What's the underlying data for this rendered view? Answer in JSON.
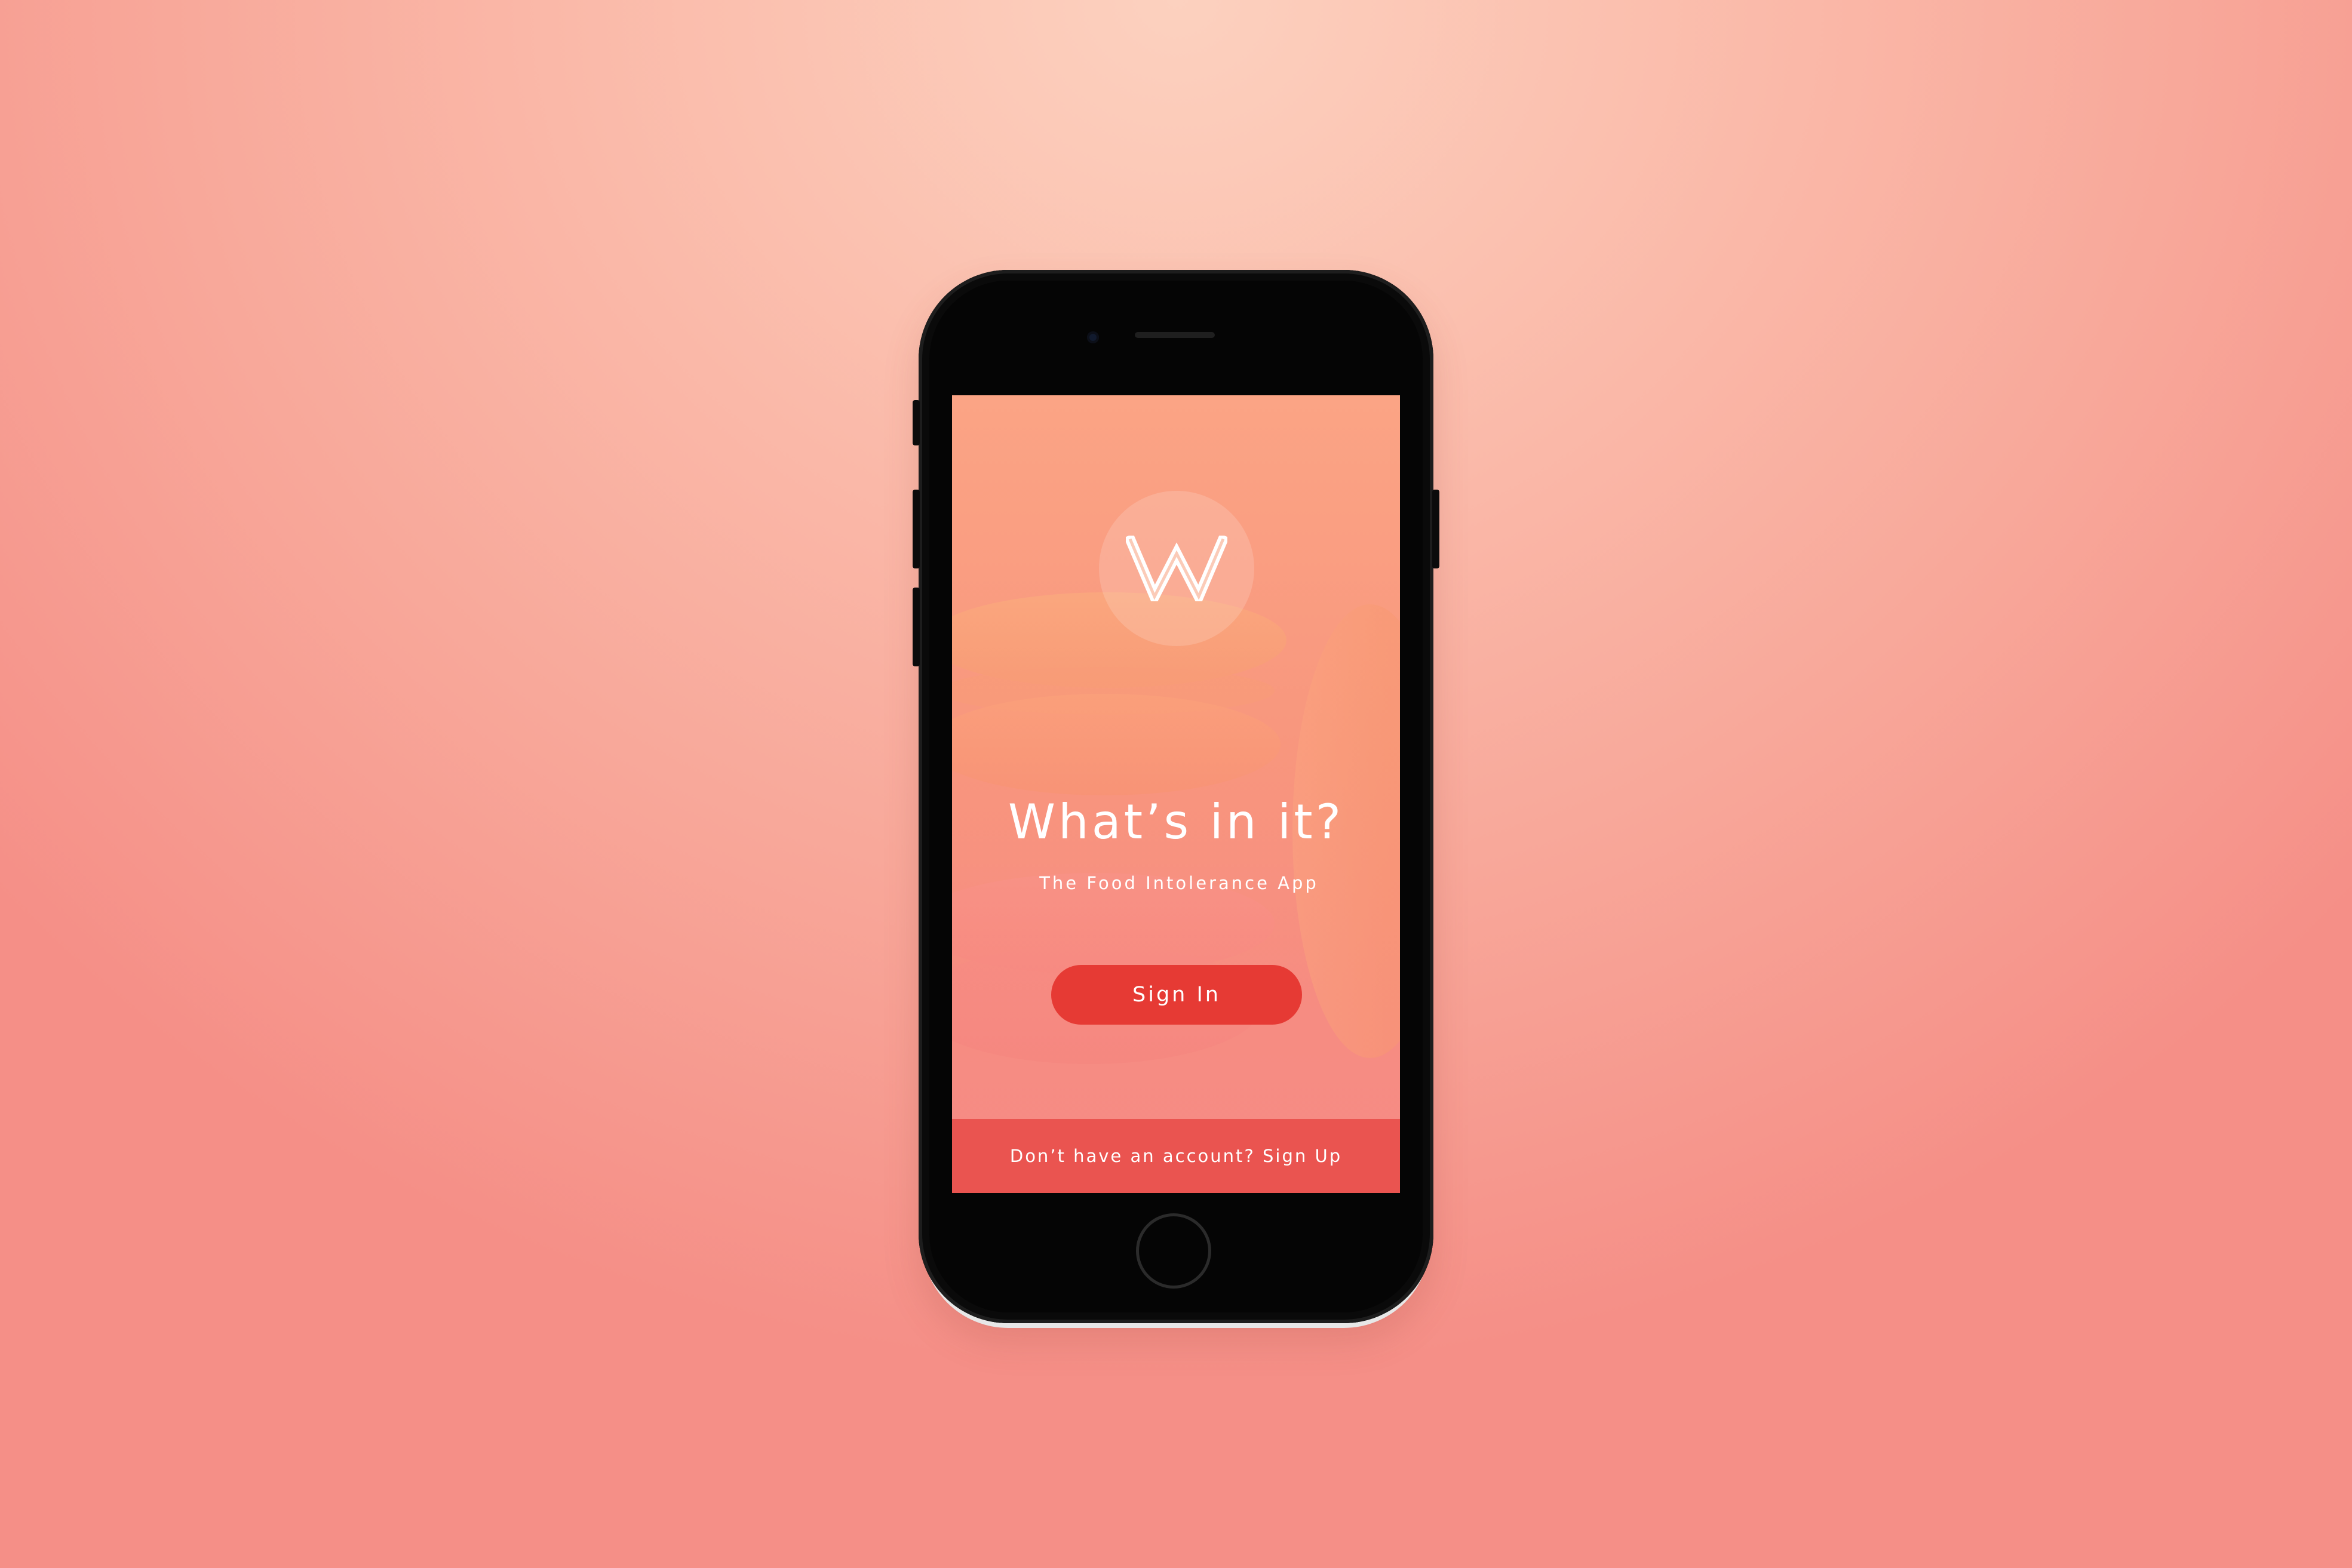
{
  "app": {
    "logo_letter": "W",
    "title": "What’s in it?",
    "subtitle": "The Food Intolerance App"
  },
  "actions": {
    "signin_label": "Sign In",
    "signup_text": "Don’t have an account? Sign Up"
  },
  "colors": {
    "background_top": "#fcd1bf",
    "background_bottom": "#f58f87",
    "screen_top": "#fba485",
    "screen_bottom": "#f58a86",
    "signin_button": "#e63a34",
    "signup_bar": "#ea5450",
    "phone_body": "#050505"
  },
  "icons": {
    "logo": "w-logo-icon",
    "home": "home-button"
  }
}
